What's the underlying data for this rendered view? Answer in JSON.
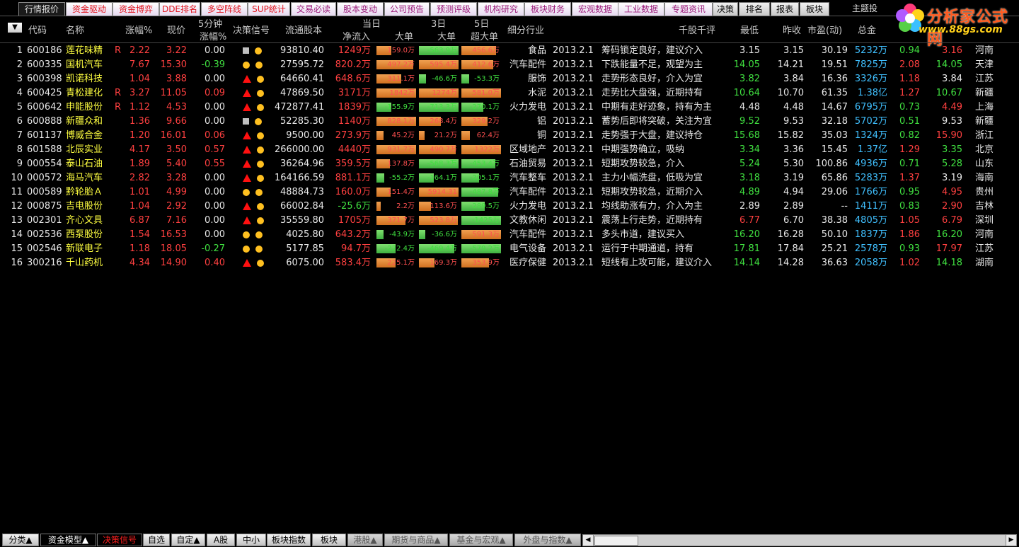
{
  "top_tabs": [
    "行情报价",
    "资金驱动",
    "资金博弈",
    "DDE排名",
    "多空阵线",
    "SUP统计",
    "交易必读",
    "股本变动",
    "公司预告",
    "预测评级",
    "机构研究",
    "板块财务",
    "宏观数据",
    "工业数据",
    "专题资讯",
    "决策",
    "排名",
    "报表",
    "板块",
    "主题投"
  ],
  "logo": {
    "brand": "分析家公式网",
    "url": "www.88gs.com"
  },
  "header": {
    "menu_button": "▼",
    "code": "代码",
    "name": "名称",
    "change_pct": "涨幅%",
    "price": "现价",
    "five_min_a": "5分钟",
    "five_min_b": "涨幅%",
    "signal": "决策信号",
    "float_shares": "流通股本",
    "today": "当日",
    "net_in": "净流入",
    "big": "大单",
    "three_day": "3日",
    "big3": "大单",
    "five_day": "5日",
    "super_big": "超大单",
    "industry": "细分行业",
    "comment": "千股千评",
    "low": "最低",
    "prev_close": "昨收",
    "pe": "市盈(动)",
    "total_amount": "总金"
  },
  "rows": [
    {
      "no": "1",
      "code": "600186",
      "name": "莲花味精",
      "r": "R",
      "chg": "2.22",
      "price": "3.22",
      "m5": "0.00",
      "sig": "sq-dot",
      "float": "93810.40",
      "net": "1249万",
      "big": "159.0万",
      "big3": "-563.9万",
      "sup": "456.6万",
      "ind": "食品",
      "date": "2013.2.1",
      "cmt": "筹码锁定良好，建议介入",
      "low": "3.15",
      "prev": "3.15",
      "pe": "30.19",
      "amt": "5232万",
      "v1": "0.94",
      "v2": "3.16",
      "prov": "河南"
    },
    {
      "no": "2",
      "code": "600335",
      "name": "国机汽车",
      "r": "",
      "chg": "7.67",
      "price": "15.30",
      "m5": "-0.39",
      "sig": "dot-dot",
      "float": "27595.72",
      "net": "820.2万",
      "big": "497.2万",
      "big3": "595.4万",
      "sup": "412.6万",
      "ind": "汽车配件",
      "date": "2013.2.1",
      "cmt": "下跌能量不足，观望为主",
      "low": "14.05",
      "prev": "14.21",
      "pe": "19.51",
      "amt": "7825万",
      "v1": "2.08",
      "v2": "14.05",
      "prov": "天津"
    },
    {
      "no": "3",
      "code": "600398",
      "name": "凯诺科技",
      "r": "",
      "chg": "1.04",
      "price": "3.88",
      "m5": "0.00",
      "sig": "tri-dot",
      "float": "64660.41",
      "net": "648.6万",
      "big": "311.1万",
      "big3": "-46.6万",
      "sup": "-53.3万",
      "ind": "服饰",
      "date": "2013.2.1",
      "cmt": "走势形态良好，介入为宜",
      "low": "3.82",
      "prev": "3.84",
      "pe": "16.36",
      "amt": "3326万",
      "v1": "1.18",
      "v2": "3.84",
      "prov": "江苏"
    },
    {
      "no": "4",
      "code": "600425",
      "name": "青松建化",
      "r": "R",
      "chg": "3.27",
      "price": "11.05",
      "m5": "0.09",
      "sig": "tri-dot",
      "float": "47869.50",
      "net": "3171万",
      "big": "1842万",
      "big3": "1274万",
      "sup": "581.0万",
      "ind": "水泥",
      "date": "2013.2.1",
      "cmt": "走势比大盘强，近期持有",
      "low": "10.64",
      "prev": "10.70",
      "pe": "61.35",
      "amt": "1.38亿",
      "v1": "1.27",
      "v2": "10.67",
      "prov": "新疆"
    },
    {
      "no": "5",
      "code": "600642",
      "name": "申能股份",
      "r": "R",
      "chg": "1.12",
      "price": "4.53",
      "m5": "0.00",
      "sig": "tri-dot",
      "float": "472877.41",
      "net": "1839万",
      "big": "-155.9万",
      "big3": "-713.3万",
      "sup": "-270.1万",
      "ind": "火力发电",
      "date": "2013.2.1",
      "cmt": "中期有走好迹象，持有为主",
      "low": "4.48",
      "prev": "4.48",
      "pe": "14.67",
      "amt": "6795万",
      "v1": "0.73",
      "v2": "4.49",
      "prov": "上海"
    },
    {
      "no": "6",
      "code": "600888",
      "name": "新疆众和",
      "r": "",
      "chg": "1.36",
      "price": "9.66",
      "m5": "0.00",
      "sig": "sq-dot",
      "float": "52285.30",
      "net": "1140万",
      "big": "828.1万",
      "big3": "268.4万",
      "sup": "329.2万",
      "ind": "铝",
      "date": "2013.2.1",
      "cmt": "蓄势后即将突破，关注为宜",
      "low": "9.52",
      "prev": "9.53",
      "pe": "32.18",
      "amt": "5702万",
      "v1": "0.51",
      "v2": "9.53",
      "prov": "新疆"
    },
    {
      "no": "7",
      "code": "601137",
      "name": "博威合金",
      "r": "",
      "chg": "1.20",
      "price": "16.01",
      "m5": "0.06",
      "sig": "tri-dot",
      "float": "9500.00",
      "net": "273.9万",
      "big": "45.2万",
      "big3": "21.2万",
      "sup": "62.4万",
      "ind": "铜",
      "date": "2013.2.1",
      "cmt": "走势强于大盘，建议持仓",
      "low": "15.68",
      "prev": "15.82",
      "pe": "35.03",
      "amt": "1324万",
      "v1": "0.82",
      "v2": "15.90",
      "prov": "浙江"
    },
    {
      "no": "8",
      "code": "601588",
      "name": "北辰实业",
      "r": "",
      "chg": "4.17",
      "price": "3.50",
      "m5": "0.57",
      "sig": "tri-dot",
      "float": "266000.00",
      "net": "4440万",
      "big": "931.7万",
      "big3": "490.7万",
      "sup": "1322万",
      "ind": "区域地产",
      "date": "2013.2.1",
      "cmt": "中期强势确立，吸纳",
      "low": "3.34",
      "prev": "3.36",
      "pe": "15.45",
      "amt": "1.37亿",
      "v1": "1.29",
      "v2": "3.35",
      "prov": "北京"
    },
    {
      "no": "9",
      "code": "000554",
      "name": "泰山石油",
      "r": "",
      "chg": "1.89",
      "price": "5.40",
      "m5": "0.55",
      "sig": "tri-dot",
      "float": "36264.96",
      "net": "359.5万",
      "big": "137.8万",
      "big3": "-568.3万",
      "sup": "-453.4万",
      "ind": "石油贸易",
      "date": "2013.2.1",
      "cmt": "短期攻势较急，介入",
      "low": "5.24",
      "prev": "5.30",
      "pe": "100.86",
      "amt": "4936万",
      "v1": "0.71",
      "v2": "5.28",
      "prov": "山东"
    },
    {
      "no": "10",
      "code": "000572",
      "name": "海马汽车",
      "r": "",
      "chg": "2.82",
      "price": "3.28",
      "m5": "0.00",
      "sig": "tri-dot",
      "float": "164166.59",
      "net": "881.1万",
      "big": "-55.2万",
      "big3": "-164.1万",
      "sup": "-205.1万",
      "ind": "汽车整车",
      "date": "2013.2.1",
      "cmt": "主力小幅洗盘，低吸为宜",
      "low": "3.18",
      "prev": "3.19",
      "pe": "65.86",
      "amt": "5283万",
      "v1": "1.37",
      "v2": "3.19",
      "prov": "海南"
    },
    {
      "no": "11",
      "code": "000589",
      "name": "黔轮胎Ａ",
      "r": "",
      "chg": "1.01",
      "price": "4.99",
      "m5": "0.00",
      "sig": "dot-dot",
      "float": "48884.73",
      "net": "160.0万",
      "big": "151.4万",
      "big3": "5914.31",
      "sup": "-487.8万",
      "ind": "汽车配件",
      "date": "2013.2.1",
      "cmt": "短期攻势较急，近期介入",
      "low": "4.89",
      "prev": "4.94",
      "pe": "29.06",
      "amt": "1766万",
      "v1": "0.95",
      "v2": "4.95",
      "prov": "贵州"
    },
    {
      "no": "12",
      "code": "000875",
      "name": "吉电股份",
      "r": "",
      "chg": "1.04",
      "price": "2.92",
      "m5": "0.00",
      "sig": "tri-dot",
      "float": "66002.84",
      "net": "-25.6万",
      "big": "2.2万",
      "big3": "113.6万",
      "sup": "-289.5万",
      "ind": "火力发电",
      "date": "2013.2.1",
      "cmt": "均线助涨有力，介入为主",
      "low": "2.89",
      "prev": "2.89",
      "pe": "--",
      "amt": "1411万",
      "v1": "0.83",
      "v2": "2.90",
      "prov": "吉林"
    },
    {
      "no": "13",
      "code": "002301",
      "name": "齐心文具",
      "r": "",
      "chg": "6.87",
      "price": "7.16",
      "m5": "0.00",
      "sig": "tri-dot",
      "float": "35559.80",
      "net": "1705万",
      "big": "371.7万",
      "big3": "523.8万",
      "sup": "-1425万",
      "ind": "文教休闲",
      "date": "2013.2.1",
      "cmt": "震荡上行走势，近期持有",
      "low": "6.77",
      "prev": "6.70",
      "pe": "38.38",
      "amt": "4805万",
      "v1": "1.05",
      "v2": "6.79",
      "prov": "深圳"
    },
    {
      "no": "14",
      "code": "002536",
      "name": "西泵股份",
      "r": "",
      "chg": "1.54",
      "price": "16.53",
      "m5": "0.00",
      "sig": "dot-dot",
      "float": "4025.80",
      "net": "643.2万",
      "big": "-43.9万",
      "big3": "-36.6万",
      "sup": "591.3万",
      "ind": "汽车配件",
      "date": "2013.2.1",
      "cmt": "多头市道，建议买入",
      "low": "16.20",
      "prev": "16.28",
      "pe": "50.10",
      "amt": "1837万",
      "v1": "1.86",
      "v2": "16.20",
      "prov": "河南"
    },
    {
      "no": "15",
      "code": "002546",
      "name": "新联电子",
      "r": "",
      "chg": "1.18",
      "price": "18.05",
      "m5": "-0.27",
      "sig": "dot-dot",
      "float": "5177.85",
      "net": "94.7万",
      "big": "-222.4万",
      "big3": "-469.4万",
      "sup": "-579.2万",
      "ind": "电气设备",
      "date": "2013.2.1",
      "cmt": "运行于中期通道，持有",
      "low": "17.81",
      "prev": "17.84",
      "pe": "25.21",
      "amt": "2578万",
      "v1": "0.93",
      "v2": "17.97",
      "prov": "江苏"
    },
    {
      "no": "16",
      "code": "300216",
      "name": "千山药机",
      "r": "",
      "chg": "4.34",
      "price": "14.90",
      "m5": "0.40",
      "sig": "tri-dot",
      "float": "6075.00",
      "net": "583.4万",
      "big": "225.1万",
      "big3": "169.3万",
      "sup": "353.9万",
      "ind": "医疗保健",
      "date": "2013.2.1",
      "cmt": "短线有上攻可能，建议介入",
      "low": "14.14",
      "prev": "14.28",
      "pe": "36.63",
      "amt": "2058万",
      "v1": "1.02",
      "v2": "14.18",
      "prov": "湖南"
    }
  ],
  "bottom_tabs": [
    "分类▲",
    "资金模型▲",
    "决策信号",
    "自选",
    "自定▲",
    "A股",
    "中小",
    "板块指数",
    "板块",
    "港股▲",
    "期货与商品▲",
    "基金与宏观▲",
    "外盘与指数▲"
  ],
  "scroll_arrows": {
    "left": "◀",
    "right": "▶"
  }
}
